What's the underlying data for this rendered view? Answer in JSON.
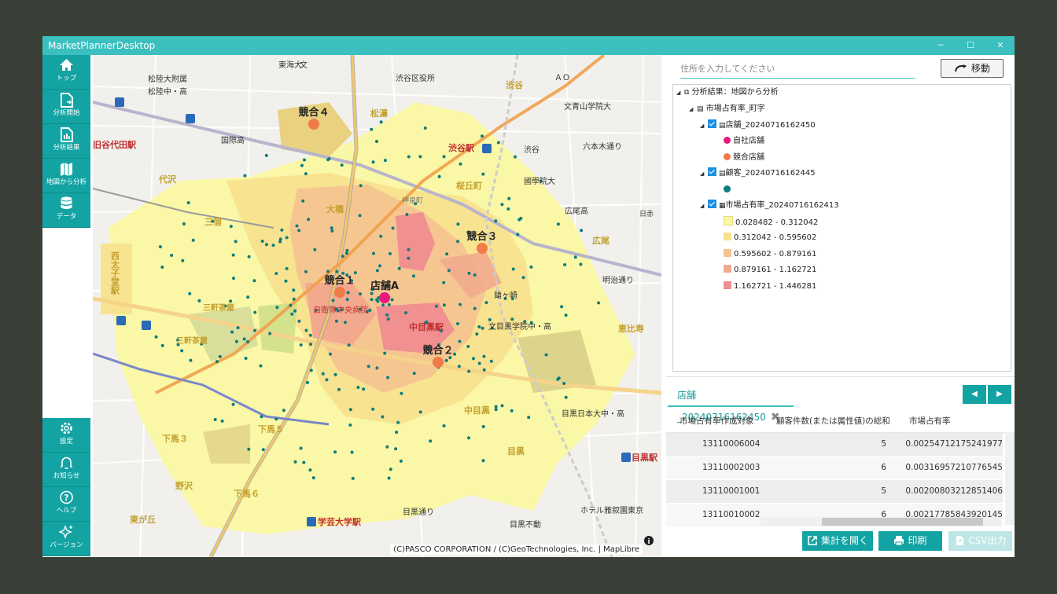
{
  "window": {
    "title": "MarketPlannerDesktop",
    "controls": [
      "─",
      "☐",
      "✕"
    ]
  },
  "sidebar": {
    "top_items": [
      {
        "label": "トップ",
        "icon": "home-icon"
      },
      {
        "label": "分析開始",
        "icon": "analysis-start-icon"
      },
      {
        "label": "分析結果",
        "icon": "analysis-result-icon"
      },
      {
        "label": "地図から分析",
        "icon": "map-icon"
      },
      {
        "label": "データ",
        "icon": "database-icon"
      }
    ],
    "bottom_items": [
      {
        "label": "設定",
        "icon": "gear-icon"
      },
      {
        "label": "お知らせ",
        "icon": "bell-icon"
      },
      {
        "label": "ヘルプ",
        "icon": "help-icon"
      },
      {
        "label": "バージョン",
        "icon": "sparkle-icon"
      }
    ]
  },
  "map": {
    "attribution": "(C)PASCO CORPORATION / (C)GeoTechnologies, Inc. | MapLibre",
    "info_icon": "info-icon",
    "stores": [
      {
        "label": "競合４"
      },
      {
        "label": "競合３"
      },
      {
        "label": "競合１"
      },
      {
        "label": "店舗A"
      },
      {
        "label": "競合２"
      }
    ],
    "labels": [
      "東海大",
      "文",
      "松陸大附属",
      "松陸中・高",
      "渋谷区役所",
      "渋谷",
      "ＡＯ",
      "文青山学院大",
      "松濤",
      "国際高",
      "渋谷駅",
      "渋谷",
      "六本木通り",
      "代々木",
      "代沢",
      "神泉町",
      "桜丘町",
      "國學院大",
      "三宿",
      "大橋",
      "広尾高",
      "日赤",
      "広尾",
      "西太子堂駅",
      "三軒茶屋",
      "競合",
      "明治通り",
      "自衛隊中央病院",
      "中目黒駅",
      "鎗ヶ崎",
      "文目黒学院中・高",
      "恵比寿",
      "三軒茶屋",
      "下馬５",
      "下馬３",
      "目黒日本大中・高",
      "中目黒",
      "目黒",
      "目黒駅",
      "野沢",
      "下馬６",
      "東が丘",
      "学芸大学駅",
      "目黒通り",
      "目黒不動",
      "ホテル雅叙園東京",
      "旧谷代田駅",
      "田駅",
      "池尻"
    ]
  },
  "panel": {
    "address_placeholder": "住所を入力してください",
    "move_button": "移動",
    "tree": {
      "root": "分析結果：地図から分析",
      "level1": "市場占有率_町字",
      "store_layer": "店舗_20240716162450",
      "store_legend": [
        {
          "label": "自社店舗",
          "color": "#e8187c"
        },
        {
          "label": "競合店舗",
          "color": "#f07a4a"
        }
      ],
      "customer_layer": "顧客_20240716162445",
      "customer_dot_color": "#0e7c7c",
      "share_layer": "市場占有率_20240716162413",
      "share_legend": [
        {
          "label": "0.028482 - 0.312042",
          "color": "#fbf7a0"
        },
        {
          "label": "0.312042 - 0.595602",
          "color": "#f8e28e"
        },
        {
          "label": "0.595602 - 0.879161",
          "color": "#f5c491"
        },
        {
          "label": "0.879161 - 1.162721",
          "color": "#f2a88e"
        },
        {
          "label": "1.162721 - 1.446281",
          "color": "#ef8d91"
        }
      ]
    },
    "tab": {
      "label": "店舗_20240716162450",
      "close": "✖",
      "prev": "◀",
      "next": "▶"
    },
    "grid": {
      "columns": [
        "市場占有率作成対象",
        "顧客件数(または属性値)の総和",
        "市場占有率"
      ],
      "rows": [
        [
          "13110006004",
          "5",
          "0.00254712175241977"
        ],
        [
          "13110002003",
          "6",
          "0.00316957210776545"
        ],
        [
          "13110001001",
          "5",
          "0.00200803212851406"
        ],
        [
          "13110010002",
          "6",
          "0.00217785843920145"
        ]
      ]
    },
    "buttons": {
      "open": "集計を開く",
      "print": "印刷",
      "csv": "CSV出力"
    }
  }
}
